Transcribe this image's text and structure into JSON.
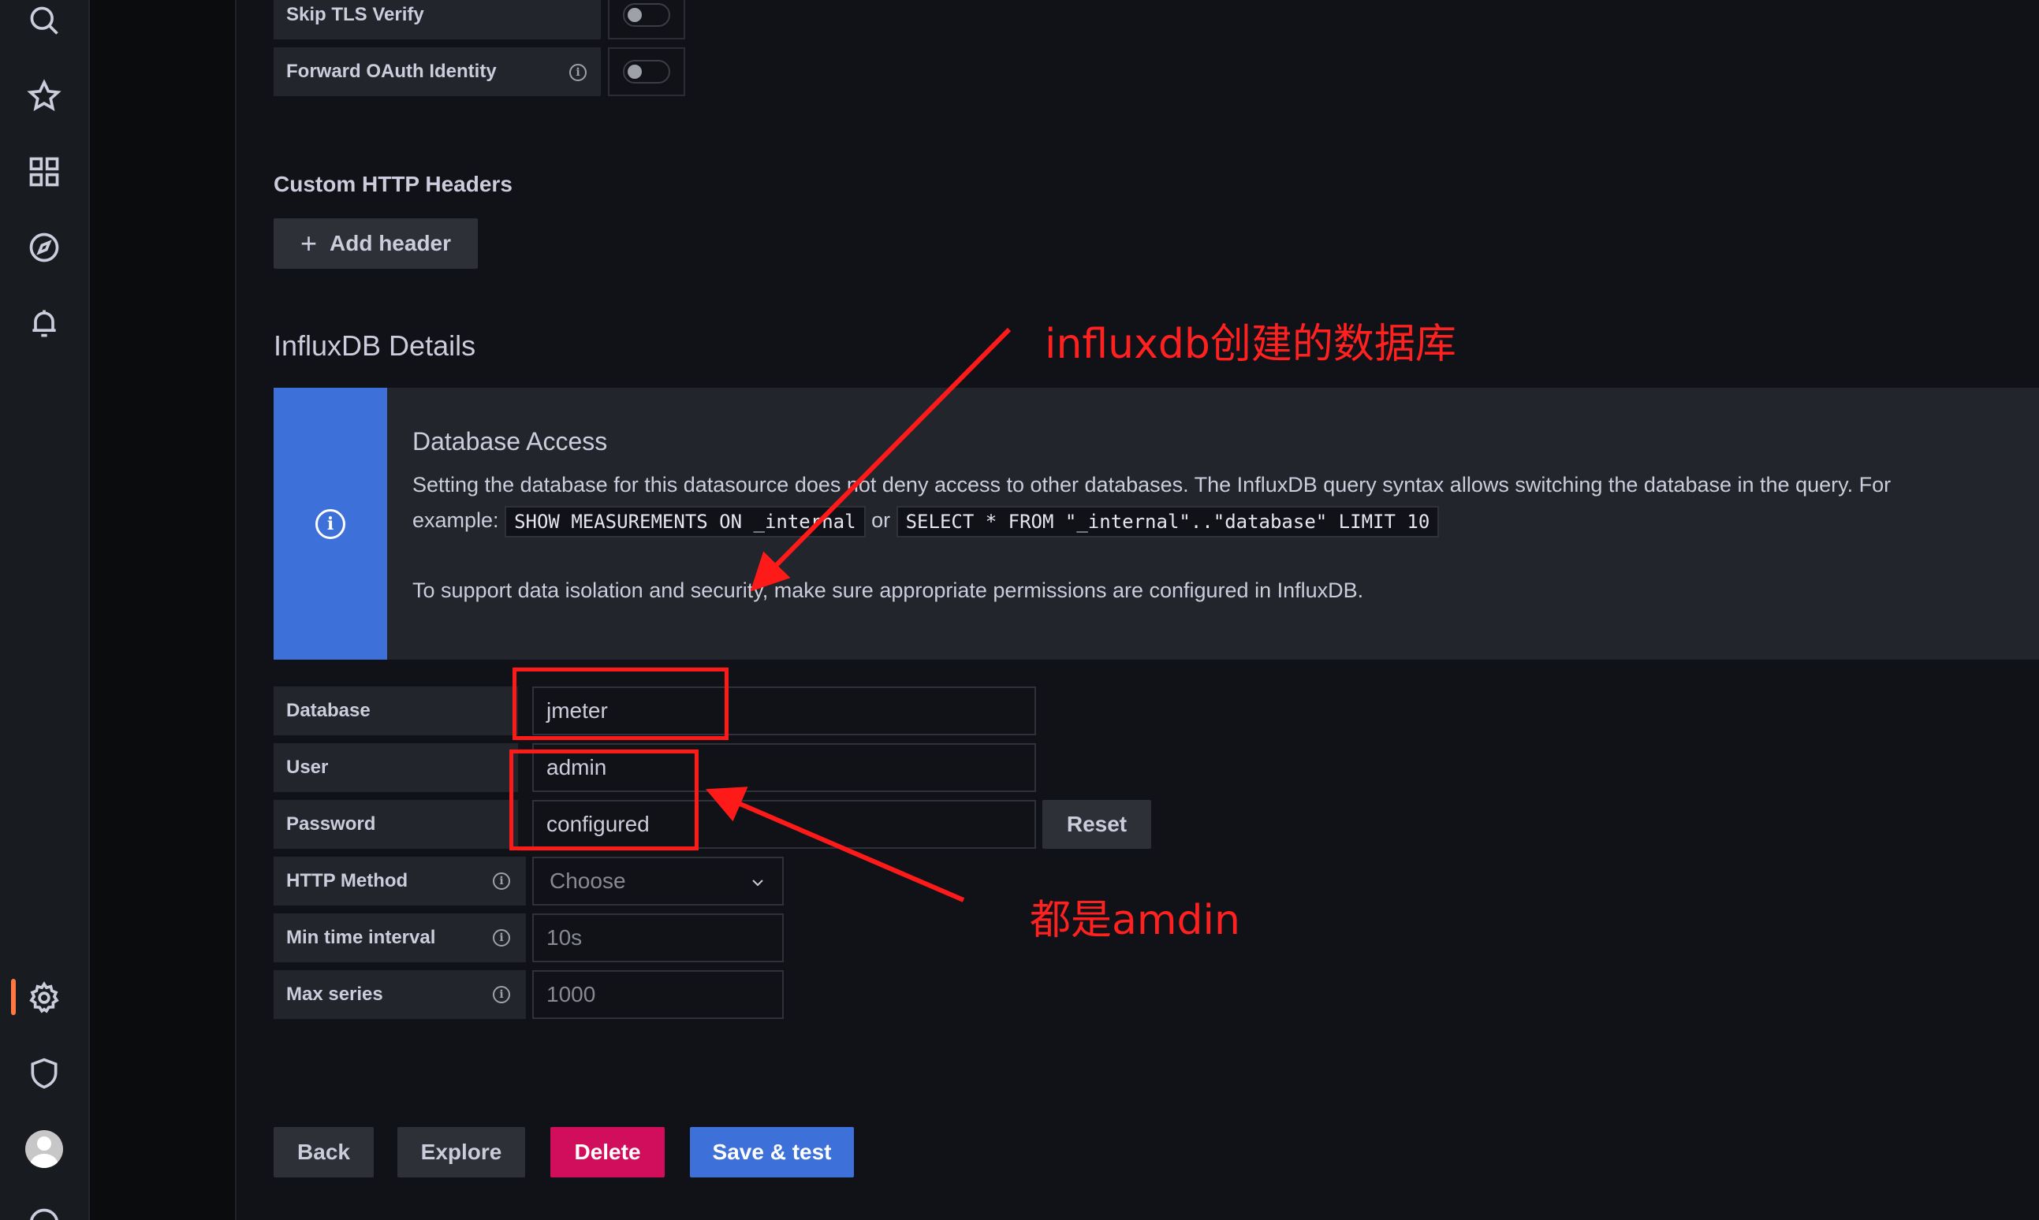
{
  "sidebar": {
    "icons": [
      "search-icon",
      "star-icon",
      "dashboards-icon",
      "explore-icon",
      "alerting-icon",
      "gear-icon",
      "shield-icon",
      "avatar",
      "help-icon"
    ],
    "active_color": "#ff7941"
  },
  "http_settings": {
    "skip_tls_label": "Skip TLS Verify",
    "forward_oauth_label": "Forward OAuth Identity",
    "custom_headers_title": "Custom HTTP Headers",
    "add_header_label": "Add header",
    "add_header_icon": "+"
  },
  "influx": {
    "section_title": "InfluxDB Details",
    "alert": {
      "title": "Database Access",
      "line1": "Setting the database for this datasource does not deny access to other databases. The InfluxDB query syntax allows switching the database in the query. For",
      "example_label": "example:",
      "code1": "SHOW MEASUREMENTS ON _internal",
      "or_label": "or",
      "code2": "SELECT * FROM \"_internal\"..\"database\" LIMIT 10",
      "line3": "To support data isolation and security, make sure appropriate permissions are configured in InfluxDB.",
      "icon": "i"
    },
    "fields": {
      "database_label": "Database",
      "database_value": "jmeter",
      "user_label": "User",
      "user_value": "admin",
      "password_label": "Password",
      "password_value": "configured",
      "reset_label": "Reset",
      "http_method_label": "HTTP Method",
      "http_method_placeholder": "Choose",
      "min_interval_label": "Min time interval",
      "min_interval_placeholder": "10s",
      "max_series_label": "Max series",
      "max_series_placeholder": "1000"
    }
  },
  "actions": {
    "back": "Back",
    "explore": "Explore",
    "delete": "Delete",
    "save_test": "Save & test"
  },
  "annotations": {
    "database_note": "influxdb创建的数据库",
    "credentials_note": "都是amdin"
  },
  "colors": {
    "primary": "#3d71d9",
    "danger": "#d10e5c",
    "annotation": "#ff1a1a"
  }
}
